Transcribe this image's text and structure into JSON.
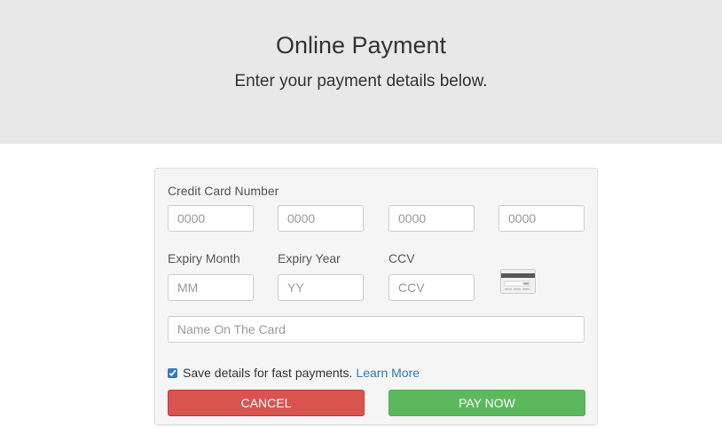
{
  "header": {
    "title": "Online Payment",
    "subtitle": "Enter your payment details below."
  },
  "form": {
    "card_number_label": "Credit Card Number",
    "card_number_placeholders": [
      "0000",
      "0000",
      "0000",
      "0000"
    ],
    "expiry_month_label": "Expiry Month",
    "expiry_month_placeholder": "MM",
    "expiry_year_label": "Expiry Year",
    "expiry_year_placeholder": "YY",
    "ccv_label": "CCV",
    "ccv_placeholder": "CCV",
    "name_placeholder": "Name On The Card",
    "save_details_label": "Save details for fast payments.",
    "save_details_checked": true,
    "learn_more_link": "Learn More",
    "cancel_button": "CANCEL",
    "pay_button": "PAY NOW"
  },
  "icons": {
    "card_icon": "credit-card-back-icon"
  },
  "colors": {
    "cancel": "#d9534f",
    "pay": "#5cb85c",
    "link": "#337ab7",
    "header_bg": "#e8e8e8"
  }
}
